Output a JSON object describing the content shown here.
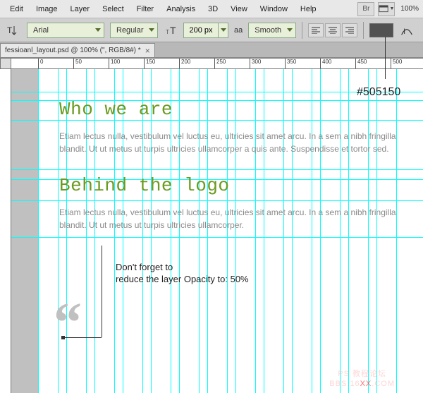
{
  "menu": {
    "items": [
      "Edit",
      "Image",
      "Layer",
      "Select",
      "Filter",
      "Analysis",
      "3D",
      "View",
      "Window",
      "Help"
    ],
    "bridge_label": "Br",
    "zoom_display": "100%"
  },
  "options": {
    "font_family": "Arial",
    "font_style": "Regular",
    "font_size": "200 px",
    "aa_prefix": "aa",
    "aa_mode": "Smooth",
    "text_color": "#505150"
  },
  "tab": {
    "title": "fessioanl_layout.psd @ 100% (\", RGB/8#) *"
  },
  "ruler": {
    "ticks": [
      "0",
      "50",
      "100",
      "150",
      "200",
      "250",
      "300",
      "350",
      "400",
      "450",
      "500"
    ]
  },
  "document": {
    "h1": "Who we are",
    "p1": "Etiam lectus nulla, vestibulum vel luctus eu, ultricies sit amet arcu. In a sem a nibh fringilla blandit. Ut ut metus ut turpis ultricies ullamcorper a quis ante. Suspendisse et tortor sed.",
    "h2": "Behind the logo",
    "p2": "Etiam lectus nulla, vestibulum vel luctus eu, ultricies sit amet arcu. In a sem a nibh fringilla blandit. Ut ut metus ut turpis ultricies ullamcorper.",
    "quote_glyph": "“"
  },
  "annotation": {
    "color_label": "#505150",
    "tip_line1": "Don't forget to",
    "tip_line2": "reduce the layer Opacity to: 50%"
  },
  "watermark": {
    "line1": "PS 教程论坛",
    "line2_a": "BBS.16",
    "line2_b": "XX",
    "line2_c": ".COM"
  }
}
